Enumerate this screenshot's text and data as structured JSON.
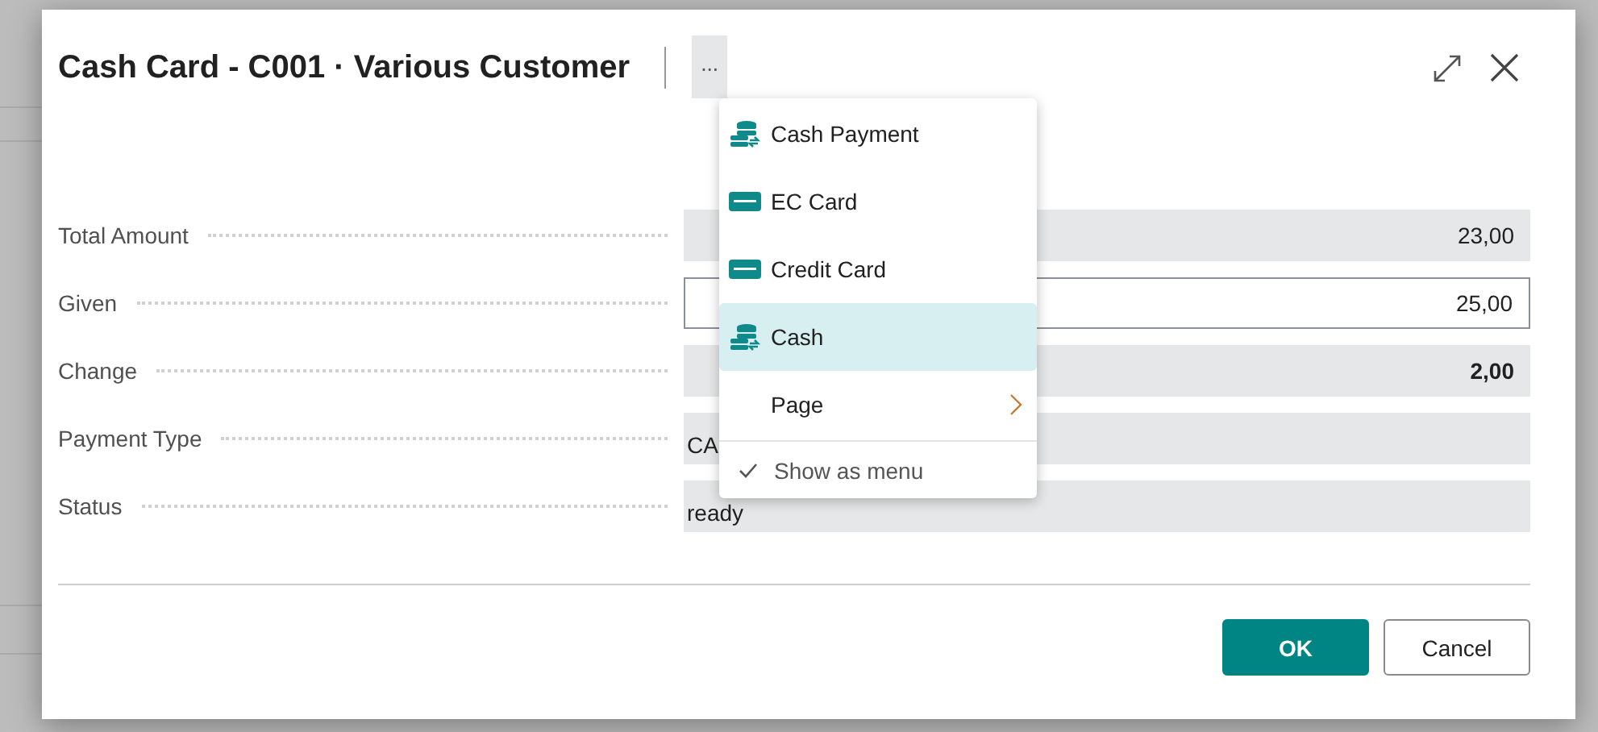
{
  "dialog": {
    "title": "Cash Card - C001 · Various Customer",
    "more_button": "···",
    "fields": [
      {
        "label": "Total Amount",
        "value": "23,00",
        "kind": "readonly-amount",
        "strong": false
      },
      {
        "label": "Given",
        "value": "25,00",
        "kind": "input-amount",
        "strong": false
      },
      {
        "label": "Change",
        "value": "2,00",
        "kind": "readonly-amount",
        "strong": true
      },
      {
        "label": "Payment Type",
        "value": "CA",
        "kind": "readonly-text",
        "strong": false
      },
      {
        "label": "Status",
        "value": "ready",
        "kind": "readonly-text",
        "strong": false
      }
    ],
    "buttons": [
      {
        "label": "OK",
        "kind": "primary"
      },
      {
        "label": "Cancel",
        "kind": "secondary"
      }
    ]
  },
  "menu": {
    "items": [
      {
        "label": "Cash Payment",
        "kind": "cash",
        "selected": false
      },
      {
        "label": "EC Card",
        "kind": "card",
        "selected": false
      },
      {
        "label": "Credit Card",
        "kind": "card",
        "selected": false
      },
      {
        "label": "Cash",
        "kind": "cash",
        "selected": true
      },
      {
        "label": "Page",
        "kind": "submenu",
        "selected": false
      },
      {
        "label": "Show as menu",
        "kind": "toggle",
        "checked": true
      }
    ]
  }
}
